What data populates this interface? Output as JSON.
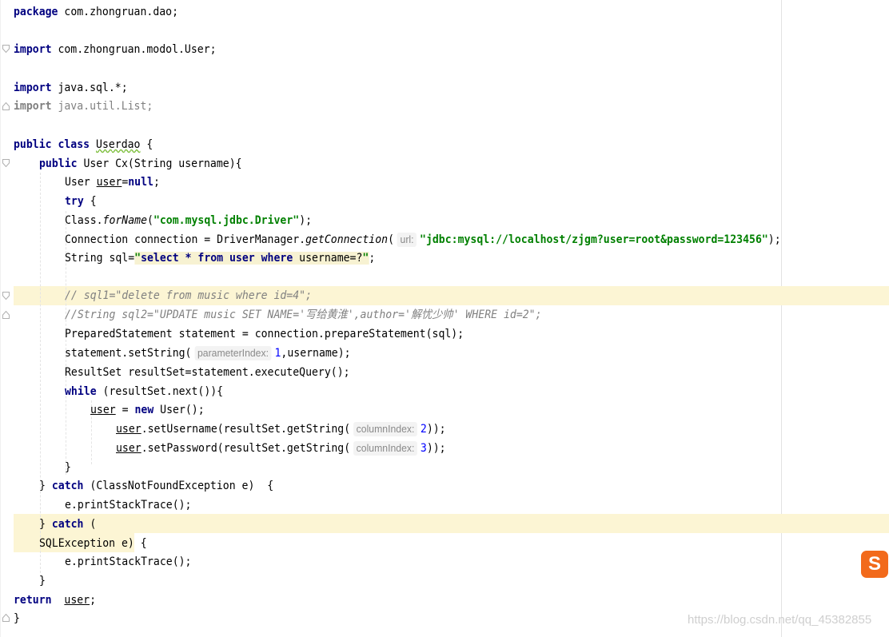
{
  "code": {
    "l1_kw": "package",
    "l1_rest": " com.zhongruan.dao;",
    "l2_kw": "import",
    "l2_rest": " com.zhongruan.modol.User;",
    "l3_kw": "import",
    "l3_rest": " java.sql.*;",
    "l4_kw": "import",
    "l4_rest": " java.util.List;",
    "l5_kw": "public class",
    "l5_name": "Userdao",
    "l5_rest": " {",
    "l6_kw": "public",
    "l6_rest": " User Cx(String username){",
    "l7_a": "User ",
    "l7_var": "user",
    "l7_eq": "=",
    "l7_null": "null",
    "l7_end": ";",
    "l8_kw": "try",
    "l8_rest": " {",
    "l9_a": "Class.",
    "l9_m": "forName",
    "l9_b": "(",
    "l9_str": "\"com.mysql.jdbc.Driver\"",
    "l9_end": ");",
    "l10_a": "Connection connection = DriverManager.",
    "l10_m": "getConnection",
    "l10_b": "(",
    "l10_hint": "url:",
    "l10_str": "\"jdbc:mysql://localhost/zjgm?user=root&password=123456\"",
    "l10_end": ");",
    "l11_a": "String sql=",
    "l11_q": "\"",
    "l11_sql": "select * from user where",
    "l11_rest": " username=?",
    "l11_end": ";",
    "l12_cm": "// sql1=\"delete from music where id=4\";",
    "l13_cm": "//String sql2=\"UPDATE music SET NAME='写给黄淮',author='解忧少帅' WHERE id=2\";",
    "l14": "PreparedStatement statement = connection.prepareStatement(sql);",
    "l15_a": "statement.setString(",
    "l15_hint": "parameterIndex:",
    "l15_num": "1",
    "l15_end": ",username);",
    "l16": "ResultSet resultSet=statement.executeQuery();",
    "l17_kw": "while",
    "l17_rest": " (resultSet.next()){",
    "l18_var": "user",
    "l18_eq": " = ",
    "l18_kw": "new",
    "l18_rest": " User();",
    "l19_var": "user",
    "l19_a": ".setUsername(resultSet.getString(",
    "l19_hint": "columnIndex:",
    "l19_num": "2",
    "l19_end": "));",
    "l20_var": "user",
    "l20_a": ".setPassword(resultSet.getString(",
    "l20_hint": "columnIndex:",
    "l20_num": "3",
    "l20_end": "));",
    "l21": "}",
    "l22_a": "} ",
    "l22_kw": "catch",
    "l22_rest": " (ClassNotFoundException e)  {",
    "l23": "e.printStackTrace();",
    "l24_a": "} ",
    "l24_kw": "catch",
    "l24_rest": " (",
    "l25_a": "SQLException e)",
    "l25_rest": " {",
    "l26": "e.printStackTrace();",
    "l27": "}",
    "l28_kw": "return",
    "l28_sp": "  ",
    "l28_var": "user",
    "l28_end": ";",
    "l29": "}"
  },
  "watermark": "https://blog.csdn.net/qq_45382855",
  "logo_letter": "S",
  "colors": {
    "keyword": "#000080",
    "string": "#008000",
    "comment": "#808080",
    "number": "#0000ff",
    "highlight": "#fcf5d4"
  }
}
